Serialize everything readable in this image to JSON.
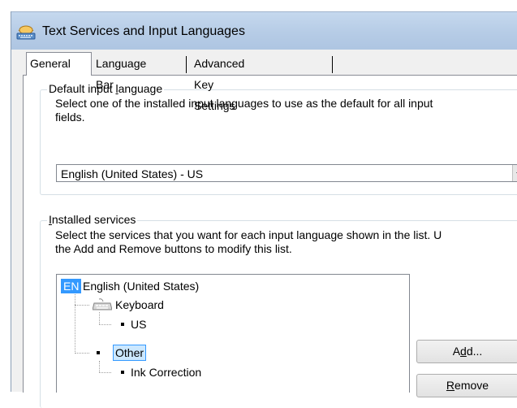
{
  "window": {
    "title": "Text Services and Input Languages",
    "title_icon": "keyboard-globe-icon"
  },
  "tabs": [
    {
      "label": "General",
      "active": true
    },
    {
      "label": "Language Bar",
      "active": false
    },
    {
      "label": "Advanced Key Settings",
      "active": false
    }
  ],
  "default_language": {
    "group_label_pre": "Default input ",
    "group_label_accel": "l",
    "group_label_post": "anguage",
    "description_line1": "Select one of the installed input languages to use as the default for all input",
    "description_line2": "fields.",
    "selected_value": "English (United States) - US"
  },
  "installed_services": {
    "group_label_accel": "I",
    "group_label_post": "nstalled services",
    "description_line1": "Select the services that you want for each input language shown in the list. U",
    "description_line2": "the Add and Remove buttons to modify this list.",
    "tree": {
      "language_badge": "EN",
      "language_name": "English (United States)",
      "keyboard_label": "Keyboard",
      "keyboard_item": "US",
      "other_label": "Other",
      "other_item": "Ink Correction"
    },
    "add_button_pre": "A",
    "add_button_accel": "d",
    "add_button_post": "d...",
    "remove_button_accel": "R",
    "remove_button_post": "emove"
  },
  "colors": {
    "accent": "#3399ff",
    "titlebar": "#b6cce6",
    "selection_bg": "#cce8ff"
  }
}
